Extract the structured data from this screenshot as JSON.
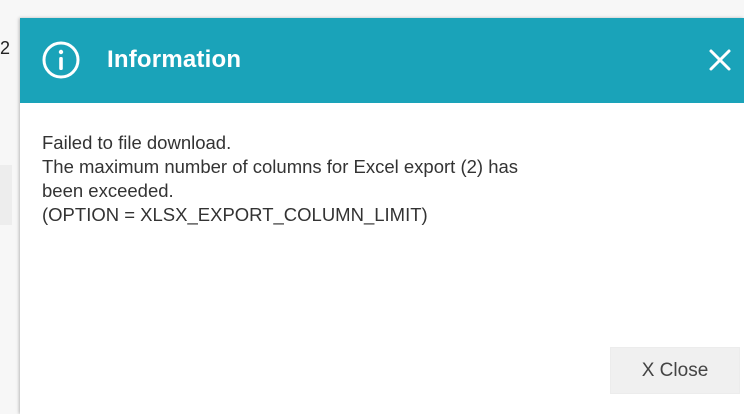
{
  "background": {
    "partial_text": "2"
  },
  "dialog": {
    "title": "Information",
    "icon": "info-icon",
    "close_icon": "close-icon",
    "message_lines": [
      "Failed to file download.",
      "The maximum number of columns for Excel export (2) has",
      "been exceeded.",
      "(OPTION = XLSX_EXPORT_COLUMN_LIMIT)"
    ],
    "close_button_label": "X Close"
  },
  "colors": {
    "header_background": "#1aa3b9",
    "header_text": "#ffffff",
    "message_text": "#333333",
    "button_background": "#f0f0f0",
    "button_text": "#444444"
  }
}
